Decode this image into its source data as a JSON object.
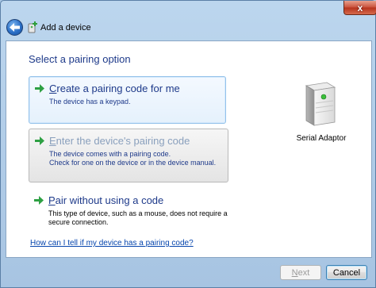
{
  "window": {
    "title": "Add a device",
    "close_label": "x"
  },
  "main": {
    "heading": "Select a pairing option",
    "options": [
      {
        "title_first": "C",
        "title_rest": "reate a pairing code for me",
        "desc": [
          "The device has a keypad."
        ]
      },
      {
        "title_first": "E",
        "title_rest": "nter the device's pairing code",
        "desc": [
          "The device comes with a pairing code.",
          "Check for one on the device or in the device manual."
        ]
      },
      {
        "title_first": "P",
        "title_rest": "air without using a code",
        "desc": [
          "This type of device, such as a mouse, does not require a",
          "secure connection."
        ]
      }
    ],
    "device_label": "Serial Adaptor",
    "help_link": "How can I tell if my device has a pairing code?"
  },
  "footer": {
    "next_first": "N",
    "next_rest": "ext",
    "cancel_label": "Cancel"
  },
  "icons": {
    "back": "back-arrow-icon",
    "title": "add-device-icon",
    "option_arrow": "green-arrow-icon",
    "device": "serial-adaptor-device-icon"
  },
  "colors": {
    "link_blue": "#1e3a8a",
    "option_arrow": "#2ea043",
    "close_red": "#c9503a"
  }
}
